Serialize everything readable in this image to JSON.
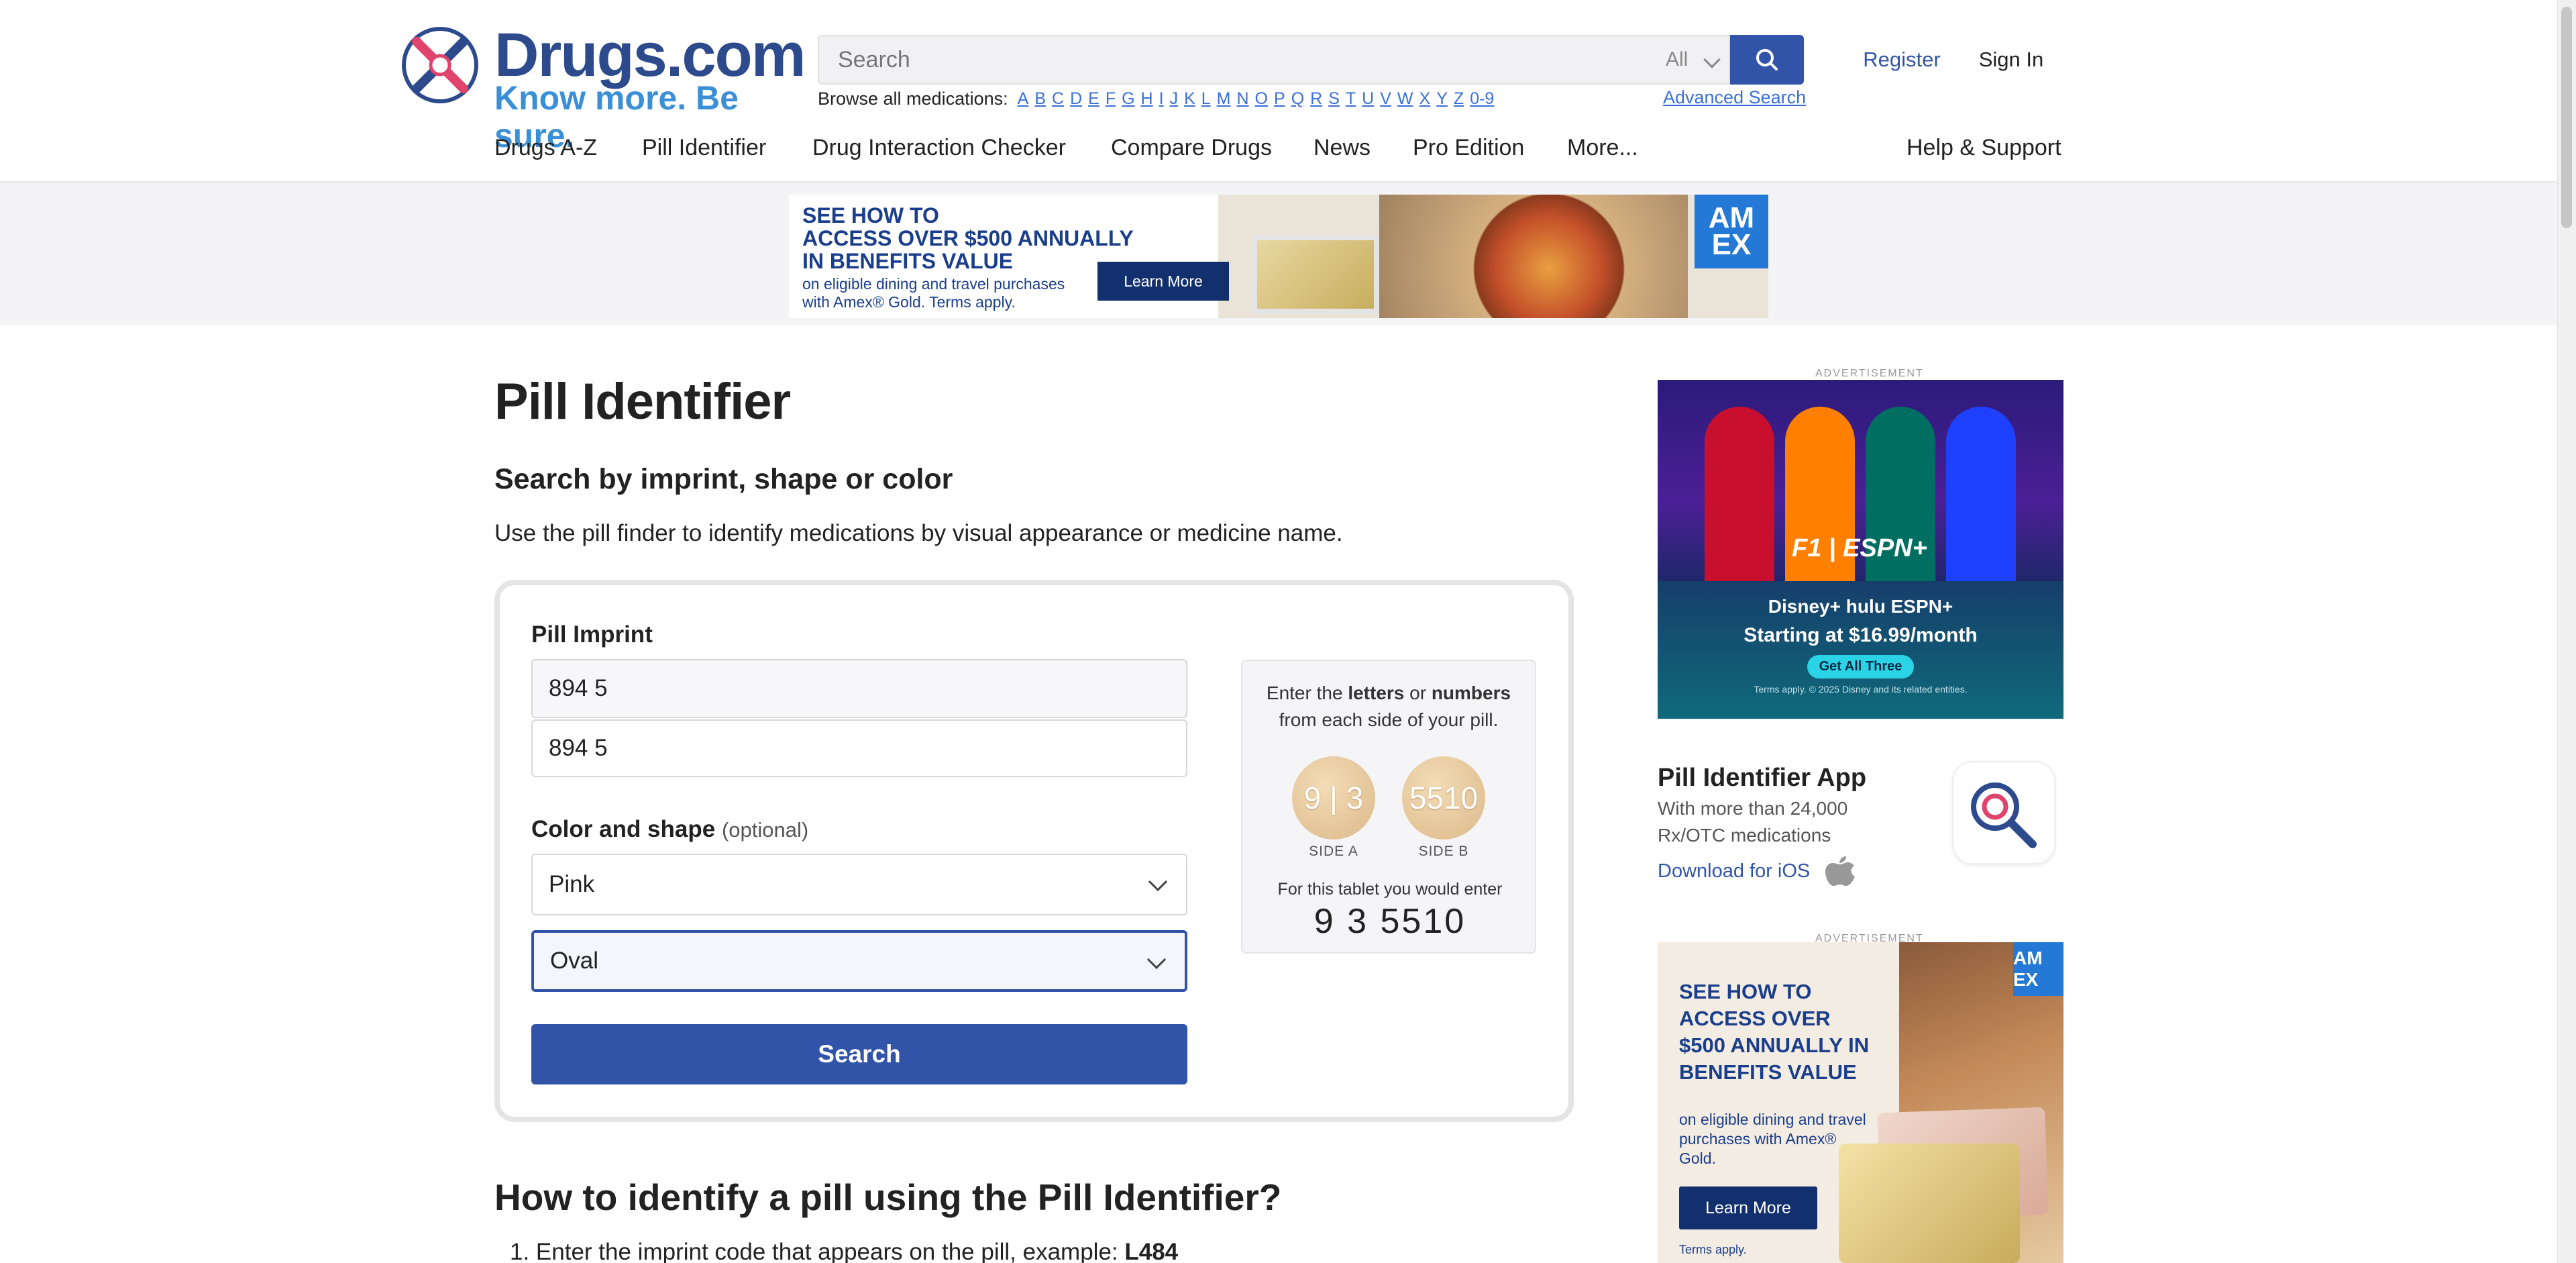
{
  "header": {
    "logo": {
      "word": "Drugs.com",
      "tagline": "Know more. Be sure."
    },
    "search": {
      "placeholder": "Search",
      "scope": "All",
      "advanced_label": "Advanced Search"
    },
    "browse_label": "Browse all medications:",
    "letters": [
      "A",
      "B",
      "C",
      "D",
      "E",
      "F",
      "G",
      "H",
      "I",
      "J",
      "K",
      "L",
      "M",
      "N",
      "O",
      "P",
      "Q",
      "R",
      "S",
      "T",
      "U",
      "V",
      "W",
      "X",
      "Y",
      "Z",
      "0-9"
    ],
    "register_label": "Register",
    "signin_label": "Sign In",
    "nav": [
      "Drugs A-Z",
      "Pill Identifier",
      "Drug Interaction Checker",
      "Compare Drugs",
      "News",
      "Pro Edition",
      "More...",
      "Help & Support"
    ]
  },
  "ads": {
    "top": {
      "headline1": "SEE HOW TO",
      "headline2": "ACCESS OVER $500 ANNUALLY",
      "headline3": "IN BENEFITS VALUE",
      "sub": "on eligible dining and travel purchases with Amex® Gold. Terms apply.",
      "cta": "Learn More",
      "badge": "AM EX"
    },
    "label": "ADVERTISEMENT",
    "right1": {
      "brand": "F1 | ESPN+",
      "logos": "Disney+ hulu ESPN+",
      "price": "Starting at $16.99/month",
      "cta": "Get All Three",
      "fine": "Terms apply. © 2025 Disney and its related entities."
    },
    "right2": {
      "copy": "SEE HOW TO ACCESS OVER $500 ANNUALLY IN BENEFITS VALUE",
      "sub": "on eligible dining and travel purchases with Amex® Gold.",
      "cta": "Learn More",
      "terms": "Terms apply.",
      "badge": "AM EX"
    }
  },
  "main": {
    "title": "Pill Identifier",
    "subtitle": "Search by imprint, shape or color",
    "lead": "Use the pill finder to identify medications by visual appearance or medicine name.",
    "form": {
      "imprint_label": "Pill Imprint",
      "imprint_value": "894 5",
      "imprint_suggestion": "894 5",
      "color_shape_label": "Color and shape",
      "optional": "(optional)",
      "color_value": "Pink",
      "shape_value": "Oval",
      "search_label": "Search"
    },
    "hint": {
      "pre": "Enter the ",
      "letters": "letters",
      "or": " or ",
      "numbers": "numbers",
      "post": "from each side of your pill.",
      "side_a_text": "9 | 3",
      "side_b_text": "5510",
      "side_a_label": "SIDE A",
      "side_b_label": "SIDE B",
      "footer": "For this tablet you would enter",
      "example": "9 3 5510"
    },
    "howto_title": "How to identify a pill using the Pill Identifier?",
    "step1_prefix": "1.  Enter the imprint code that appears on the pill, example: ",
    "step1_example": "L484"
  },
  "sidebar": {
    "app_title": "Pill Identifier App",
    "app_desc": "With more than 24,000 Rx/OTC medications",
    "app_ios": "Download for iOS"
  }
}
